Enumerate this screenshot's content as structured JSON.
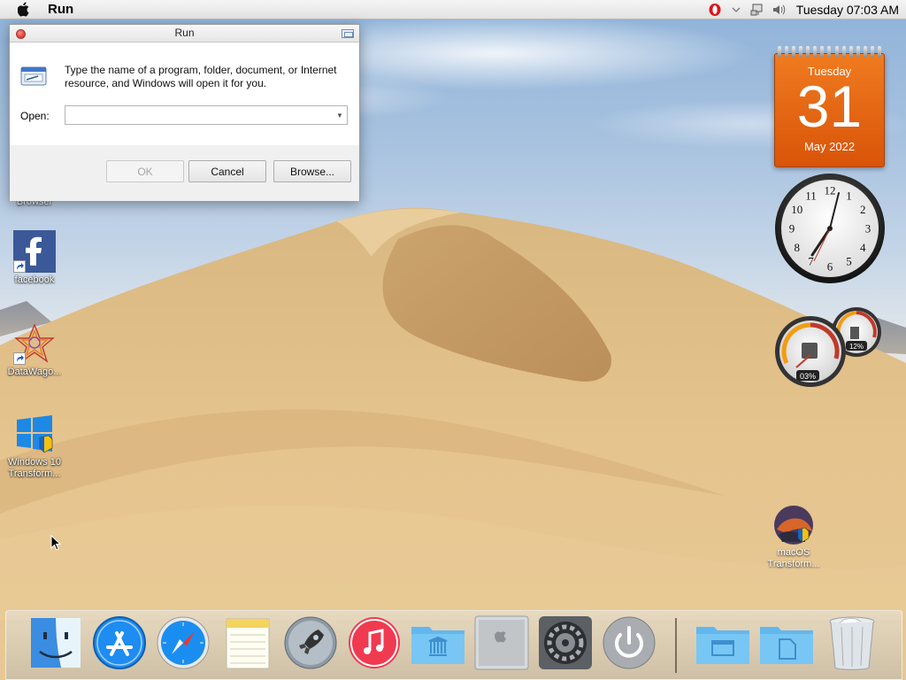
{
  "menubar": {
    "app_name": "Run",
    "clock": "Tuesday 07:03 AM"
  },
  "run_dialog": {
    "title": "Run",
    "description": "Type the name of a program, folder, document, or Internet resource, and Windows will open it for you.",
    "open_label": "Open:",
    "open_value": "",
    "ok_label": "OK",
    "cancel_label": "Cancel",
    "browse_label": "Browse..."
  },
  "desktop_icons": {
    "browser_label": "Browser",
    "facebook_label": "facebook",
    "datawago_label": "DataWago...",
    "win10_label_1": "Windows 10",
    "win10_label_2": "Transform...",
    "macos_label_1": "macOS",
    "macos_label_2": "Transform..."
  },
  "calendar": {
    "day": "Tuesday",
    "date": "31",
    "month": "May 2022"
  },
  "clock_gadget": {
    "numbers": [
      "12",
      "1",
      "2",
      "3",
      "4",
      "5",
      "6",
      "7",
      "8",
      "9",
      "10",
      "11"
    ]
  },
  "meter_gadget": {
    "cpu": "03%",
    "ram": "12%"
  },
  "dock": {
    "items": [
      "Finder",
      "App Store",
      "Safari",
      "Notes",
      "Launchpad",
      "iTunes",
      "Applications",
      "Mac Pro",
      "System Preferences",
      "Shut Down",
      "Downloads",
      "Documents",
      "Trash"
    ]
  },
  "colors": {
    "calendar_orange": "#e8650f",
    "close_red": "#e0443b"
  }
}
